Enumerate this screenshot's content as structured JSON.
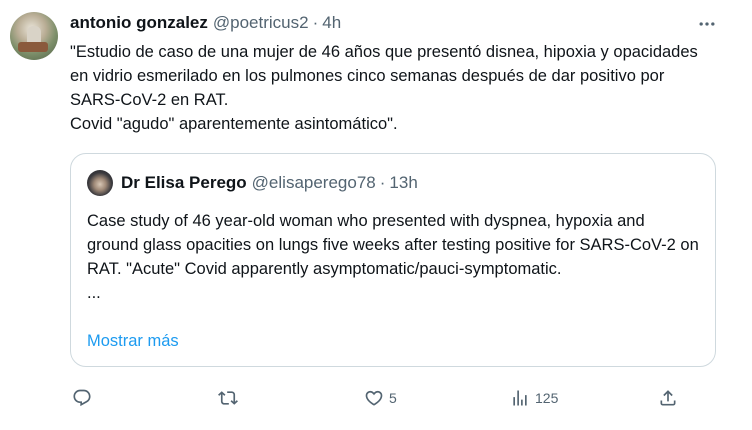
{
  "tweet": {
    "author_name": "antonio gonzalez",
    "handle": "@poetricus2",
    "separator": "·",
    "time": "4h",
    "text": "\"Estudio de caso de una mujer de 46 años que presentó disnea, hipoxia y opacidades en vidrio esmerilado en los pulmones cinco semanas después de dar positivo por SARS-CoV-2 en RAT.\n Covid \"agudo\" aparentemente asintomático\".",
    "more_icon": "more-horizontal-icon"
  },
  "quote": {
    "author_name": "Dr Elisa Perego",
    "handle": "@elisaperego78",
    "separator": "·",
    "time": "13h",
    "text": "Case study of 46 year-old woman who presented with dyspnea, hypoxia and ground glass opacities on lungs five weeks after testing positive for SARS-CoV-2 on RAT. \"Acute\" Covid apparently asymptomatic/pauci-symptomatic.\n...",
    "show_more": "Mostrar más"
  },
  "actions": {
    "reply": {
      "icon": "reply-icon",
      "count": ""
    },
    "retweet": {
      "icon": "retweet-icon",
      "count": ""
    },
    "like": {
      "icon": "heart-icon",
      "count": "5"
    },
    "views": {
      "icon": "views-chart-icon",
      "count": "125"
    },
    "share": {
      "icon": "share-icon"
    }
  },
  "colors": {
    "text_primary": "#0f1419",
    "text_secondary": "#536471",
    "link": "#1d9bf0",
    "border": "#cfd9de"
  }
}
